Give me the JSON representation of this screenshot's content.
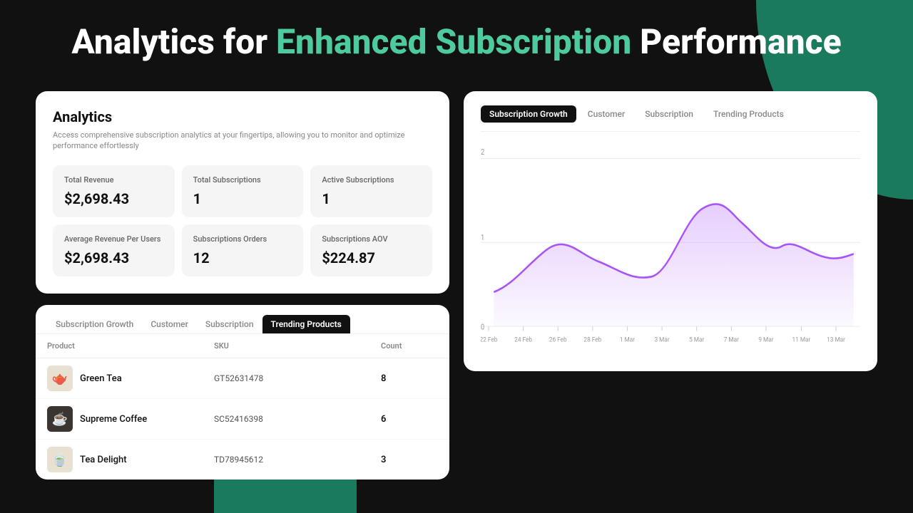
{
  "page": {
    "title_prefix": "Analytics for ",
    "title_highlight": "Enhanced Subscription",
    "title_suffix": " Performance"
  },
  "analytics": {
    "card_title": "Analytics",
    "card_subtitle": "Access comprehensive subscription analytics at your fingertips, allowing you to monitor and optimize performance effortlessly",
    "metrics": [
      {
        "label": "Total Revenue",
        "value": "$2,698.43"
      },
      {
        "label": "Total Subscriptions",
        "value": "1"
      },
      {
        "label": "Active Subscriptions",
        "value": "1"
      },
      {
        "label": "Average Revenue Per Users",
        "value": "$2,698.43"
      },
      {
        "label": "Subscriptions Orders",
        "value": "12"
      },
      {
        "label": "Subscriptions AOV",
        "value": "$224.87"
      }
    ]
  },
  "bottom_table": {
    "tabs": [
      {
        "label": "Subscription Growth",
        "active": false
      },
      {
        "label": "Customer",
        "active": false
      },
      {
        "label": "Subscription",
        "active": false
      },
      {
        "label": "Trending Products",
        "active": true
      }
    ],
    "columns": [
      "Product",
      "SKU",
      "Count"
    ],
    "rows": [
      {
        "name": "Green Tea",
        "sku": "GT52631478",
        "count": "8",
        "emoji": "🫖",
        "dark": false
      },
      {
        "name": "Supreme Coffee",
        "sku": "SC52416398",
        "count": "6",
        "emoji": "☕",
        "dark": true
      },
      {
        "name": "Tea Delight",
        "sku": "TD78945612",
        "count": "3",
        "emoji": "🍵",
        "dark": false
      }
    ]
  },
  "chart": {
    "tabs": [
      {
        "label": "Subscription Growth",
        "active": true
      },
      {
        "label": "Customer",
        "active": false
      },
      {
        "label": "Subscription",
        "active": false
      },
      {
        "label": "Trending Products",
        "active": false
      }
    ],
    "y_labels": [
      "0",
      "1",
      "2"
    ],
    "x_labels": [
      "22 Feb",
      "24 Feb",
      "26 Feb",
      "28 Feb",
      "1 Mar",
      "3 Mar",
      "5 Mar",
      "7 Mar",
      "9 Mar",
      "11 Mar",
      "13 Mar"
    ]
  }
}
